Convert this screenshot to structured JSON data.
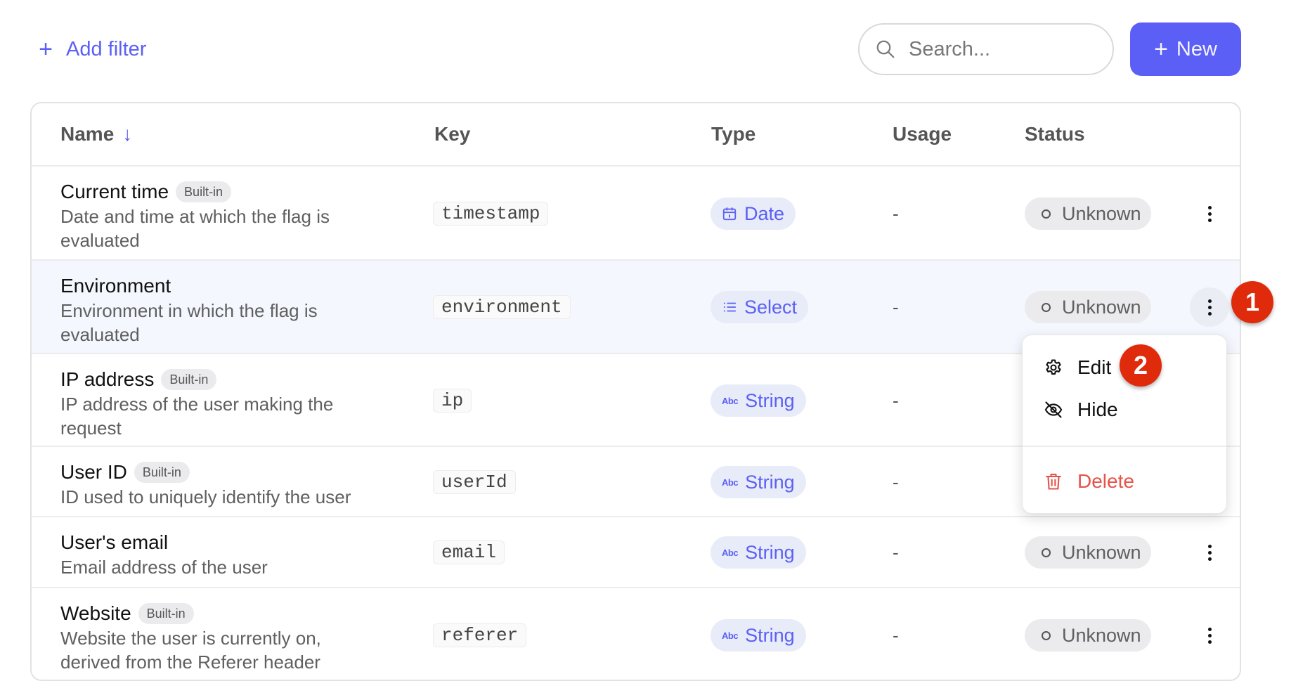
{
  "toolbar": {
    "add_filter_label": "Add filter",
    "search_placeholder": "Search...",
    "search_value": "",
    "new_label": "New"
  },
  "table": {
    "columns": {
      "name": "Name",
      "key": "Key",
      "type": "Type",
      "usage": "Usage",
      "status": "Status"
    },
    "sort": {
      "column": "Name",
      "direction": "descending"
    },
    "rows": [
      {
        "name": "Current time",
        "builtin": "Built-in",
        "description": "Date and time at which the flag is evaluated",
        "key": "timestamp",
        "type": "Date",
        "type_icon": "calendar-icon",
        "usage": "-",
        "status": "Unknown"
      },
      {
        "name": "Environment",
        "builtin": "",
        "description": "Environment in which the flag is evaluated",
        "key": "environment",
        "type": "Select",
        "type_icon": "list-icon",
        "usage": "-",
        "status": "Unknown"
      },
      {
        "name": "IP address",
        "builtin": "Built-in",
        "description": "IP address of the user making the request",
        "key": "ip",
        "type": "String",
        "type_icon": "abc-icon",
        "usage": "-",
        "status": ""
      },
      {
        "name": "User ID",
        "builtin": "Built-in",
        "description": "ID used to uniquely identify the user",
        "key": "userId",
        "type": "String",
        "type_icon": "abc-icon",
        "usage": "-",
        "status": ""
      },
      {
        "name": "User's email",
        "builtin": "",
        "description": "Email address of the user",
        "key": "email",
        "type": "String",
        "type_icon": "abc-icon",
        "usage": "-",
        "status": "Unknown"
      },
      {
        "name": "Website",
        "builtin": "Built-in",
        "description": "Website the user is currently on, derived from the Referer header",
        "key": "referer",
        "type": "String",
        "type_icon": "abc-icon",
        "usage": "-",
        "status": "Unknown"
      }
    ]
  },
  "row_menu": {
    "items": [
      {
        "label": "Edit",
        "icon": "gear-icon"
      },
      {
        "label": "Hide",
        "icon": "eye-off-icon"
      },
      {
        "label": "Delete",
        "icon": "trash-icon"
      }
    ]
  },
  "callouts": {
    "first": "1",
    "second": "2"
  },
  "colors": {
    "accent": "#5b5ff5",
    "danger": "#e5534b",
    "callout": "#e02a0c",
    "row_hover": "#f4f7fe"
  }
}
